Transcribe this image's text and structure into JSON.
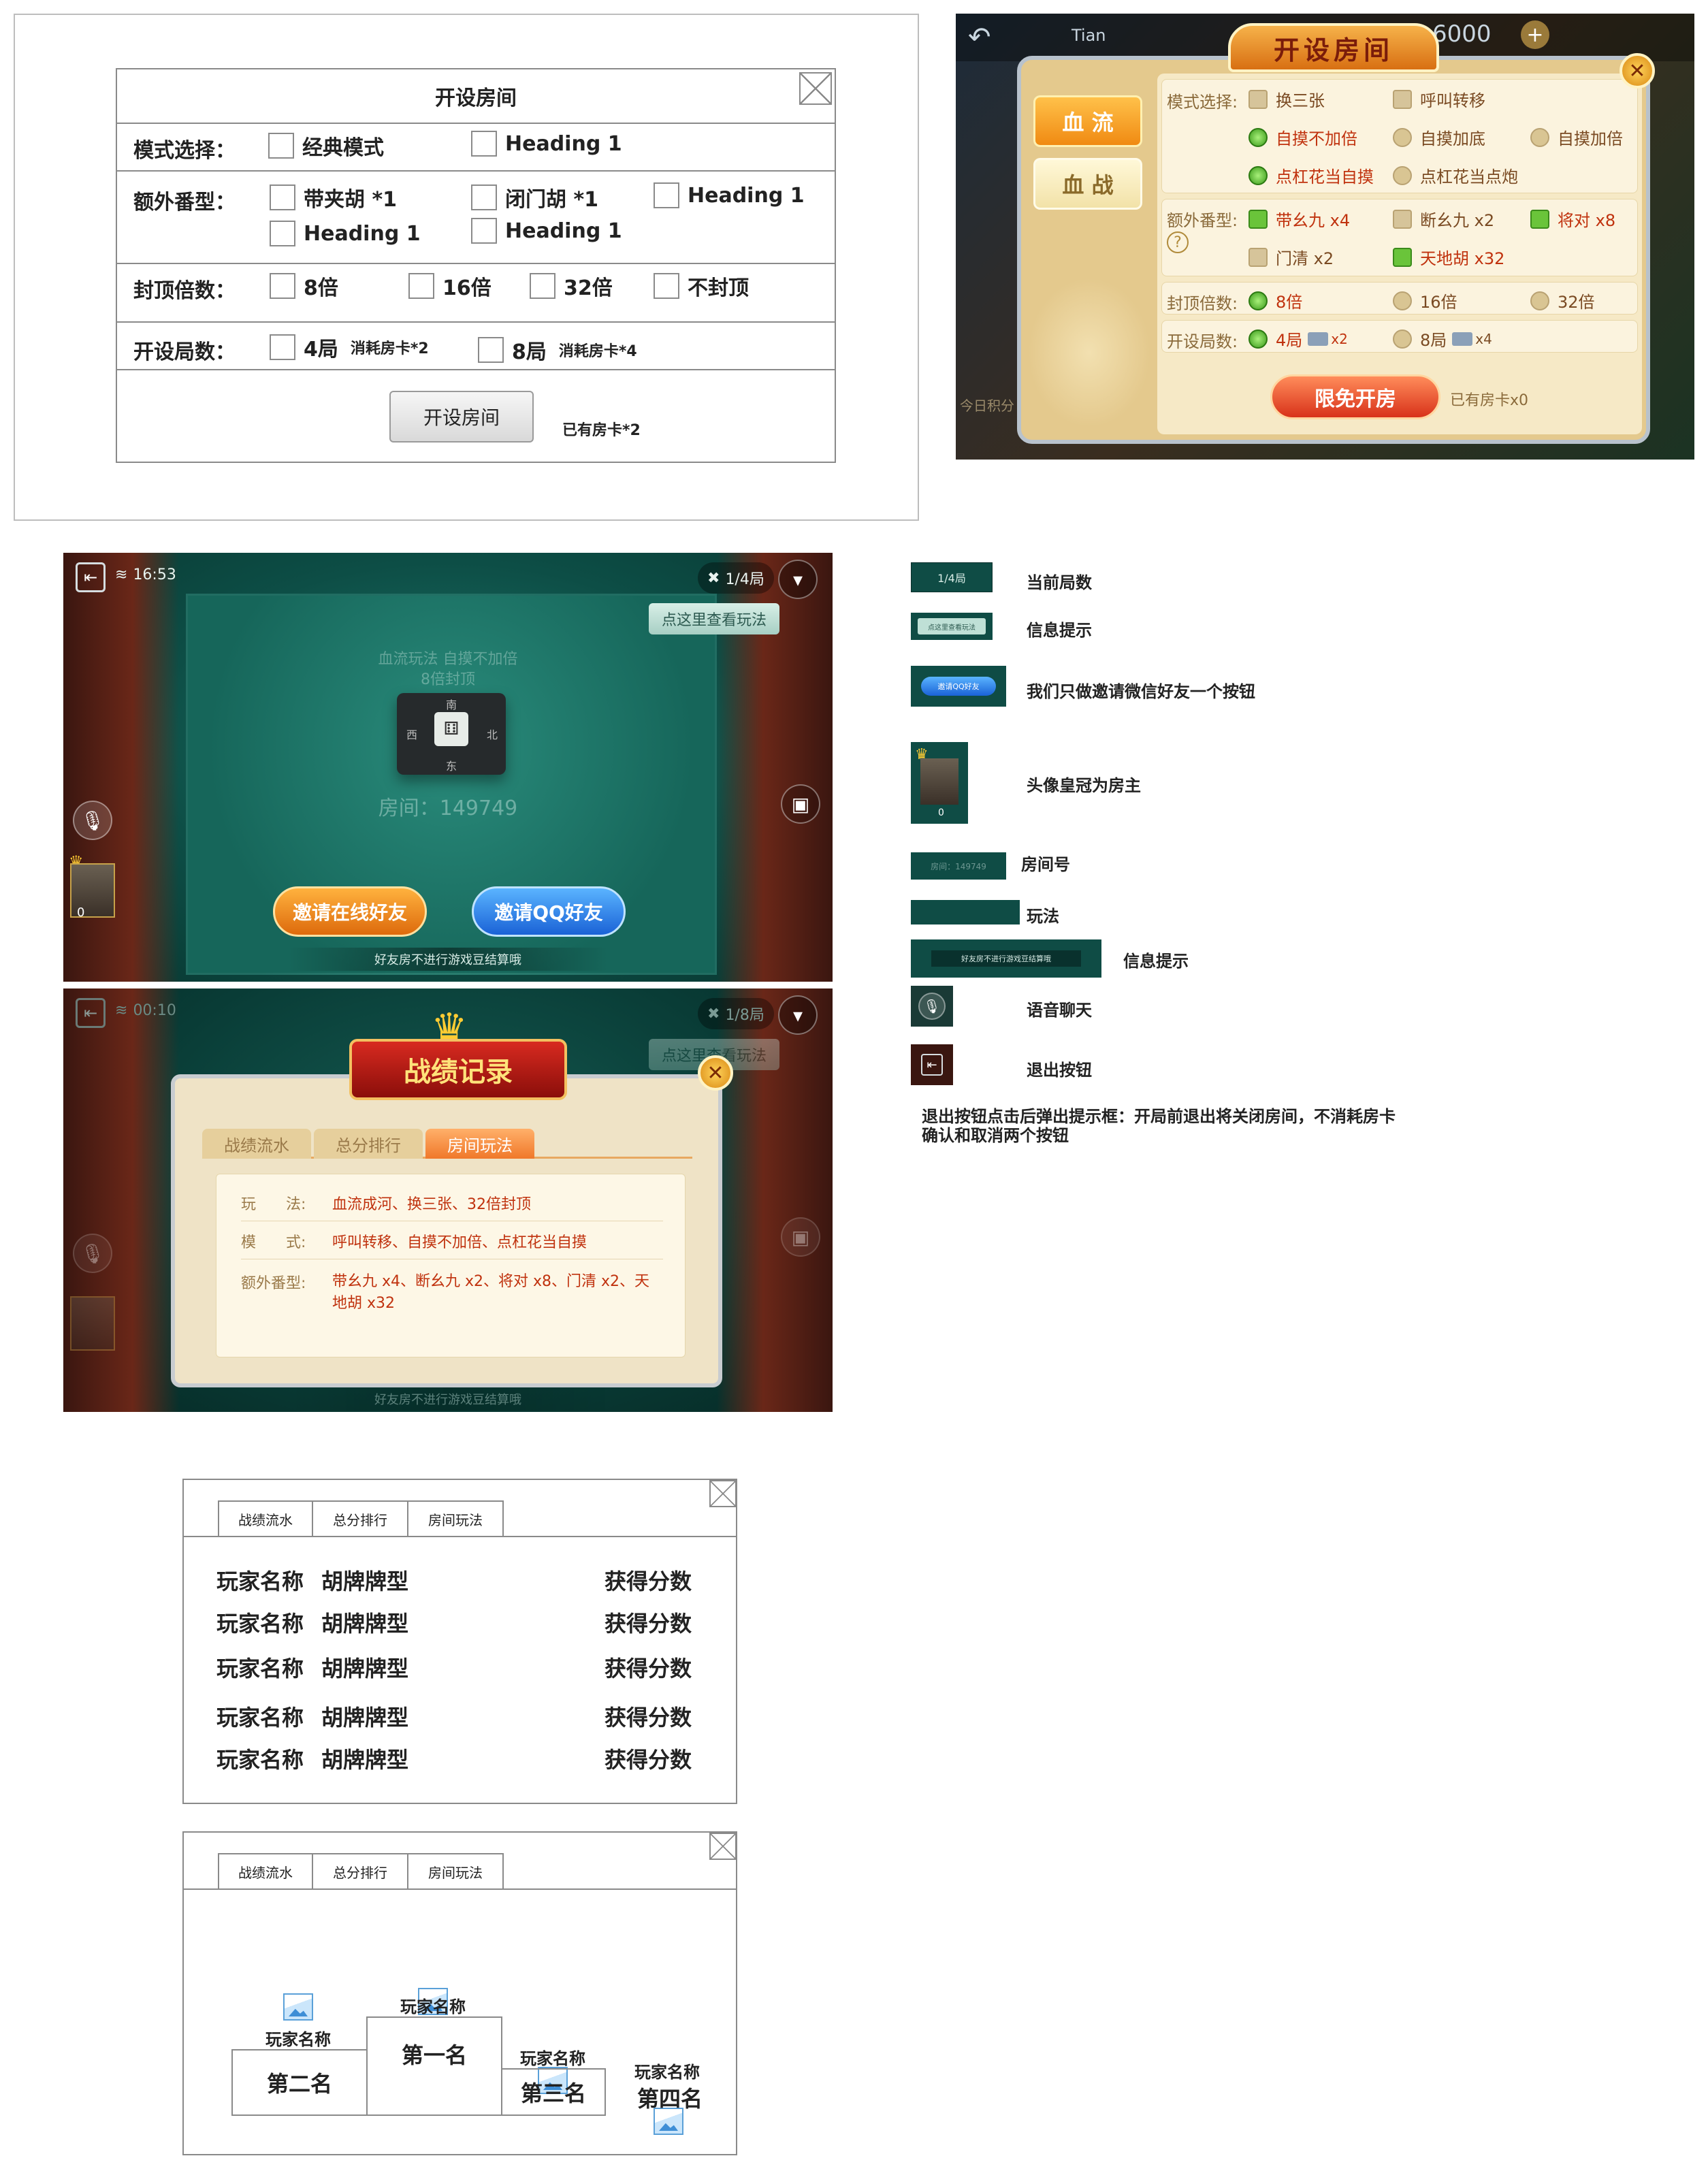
{
  "wireframe_create_room": {
    "title": "开设房间",
    "rows": {
      "mode": {
        "label": "模式选择：",
        "options": [
          "经典模式",
          "Heading 1"
        ]
      },
      "extra": {
        "label": "额外番型：",
        "options": [
          "带夹胡 *1",
          "闭门胡 *1",
          "Heading 1",
          "Heading 1",
          "Heading 1"
        ]
      },
      "cap": {
        "label": "封顶倍数：",
        "options": [
          "8倍",
          "16倍",
          "32倍",
          "不封顶"
        ]
      },
      "rounds": {
        "label": "开设局数：",
        "options": [
          {
            "label": "4局",
            "cost": "消耗房卡*2"
          },
          {
            "label": "8局",
            "cost": "消耗房卡*4"
          }
        ]
      }
    },
    "create_button": "开设房间",
    "cards_owned": "已有房卡*2"
  },
  "game_create_room": {
    "top_name": "Tian",
    "top_coins": "6000",
    "title": "开设房间",
    "tabs": [
      "血 流",
      "血 战"
    ],
    "mode_label": "模式选择:",
    "mode_options": [
      "换三张",
      "呼叫转移",
      "自摸不加倍",
      "自摸加底",
      "自摸加倍",
      "点杠花当自摸",
      "点杠花当点炮"
    ],
    "extra_label": "额外番型:",
    "extra_options": [
      "带幺九 x4",
      "断幺九 x2",
      "将对 x8",
      "门清 x2",
      "天地胡 x32"
    ],
    "help_icon_text": "?",
    "cap_label": "封顶倍数:",
    "cap_options": [
      "8倍",
      "16倍",
      "32倍"
    ],
    "rounds_label": "开设局数:",
    "rounds_options": [
      {
        "label": "4局",
        "cost": "x2"
      },
      {
        "label": "8局",
        "cost": "x4"
      }
    ],
    "create_button": "限免开房",
    "cards_owned": "已有房卡x0",
    "side_text": "今日积分"
  },
  "table_screen": {
    "time": "16:53",
    "round": "1/4局",
    "rules_hint": "点这里查看玩法",
    "rules_line1": "血流玩法 自摸不加倍",
    "rules_line2": "8倍封顶",
    "compass": [
      "南",
      "北",
      "西",
      "东"
    ],
    "room_number": "房间：149749",
    "avatar_score": "0",
    "invite_online": "邀请在线好友",
    "invite_qq": "邀请QQ好友",
    "bottom_note": "好友房不进行游戏豆结算哦"
  },
  "record_screen": {
    "time": "00:10",
    "round": "1/8局",
    "rules_hint": "点这里查看玩法",
    "title": "战绩记录",
    "tabs": [
      "战绩流水",
      "总分排行",
      "房间玩法"
    ],
    "rows": [
      {
        "label": "玩　　法:",
        "value": "血流成河、换三张、32倍封顶"
      },
      {
        "label": "模　　式:",
        "value": "呼叫转移、自摸不加倍、点杠花当自摸"
      },
      {
        "label": "额外番型:",
        "value": "带幺九 x4、断幺九 x2、将对 x8、门清 x2、天地胡 x32"
      }
    ],
    "bottom_note": "好友房不进行游戏豆结算哦"
  },
  "legend": [
    {
      "thumb": "1/4局",
      "text": "当前局数"
    },
    {
      "thumb": "点这里查看玩法",
      "text": "信息提示"
    },
    {
      "thumb": "邀请QQ好友",
      "text": "我们只做邀请微信好友一个按钮"
    },
    {
      "thumb": "0",
      "text": "头像皇冠为房主"
    },
    {
      "thumb": "房间：149749",
      "text": "房间号"
    },
    {
      "thumb": "",
      "text": "玩法"
    },
    {
      "thumb": "好友房不进行游戏豆结算哦",
      "text": "信息提示"
    },
    {
      "thumb": "",
      "text": "语音聊天"
    },
    {
      "thumb": "",
      "text": "退出按钮"
    }
  ],
  "legend_note_line1": "退出按钮点击后弹出提示框：开局前退出将关闭房间，不消耗房卡",
  "legend_note_line2": "确认和取消两个按钮",
  "wireframe_records": {
    "tabs": [
      "战绩流水",
      "总分排行",
      "房间玩法"
    ],
    "rows": [
      {
        "name": "玩家名称",
        "hand": "胡牌牌型",
        "score": "获得分数"
      },
      {
        "name": "玩家名称",
        "hand": "胡牌牌型",
        "score": "获得分数"
      },
      {
        "name": "玩家名称",
        "hand": "胡牌牌型",
        "score": "获得分数"
      },
      {
        "name": "玩家名称",
        "hand": "胡牌牌型",
        "score": "获得分数"
      },
      {
        "name": "玩家名称",
        "hand": "胡牌牌型",
        "score": "获得分数"
      }
    ]
  },
  "wireframe_ranking": {
    "tabs": [
      "战绩流水",
      "总分排行",
      "房间玩法"
    ],
    "places": [
      {
        "name": "玩家名称",
        "rank": "第二名"
      },
      {
        "name": "玩家名称",
        "rank": "第一名"
      },
      {
        "name": "玩家名称",
        "rank": "第三名"
      },
      {
        "name": "玩家名称",
        "rank": "第四名"
      }
    ]
  }
}
